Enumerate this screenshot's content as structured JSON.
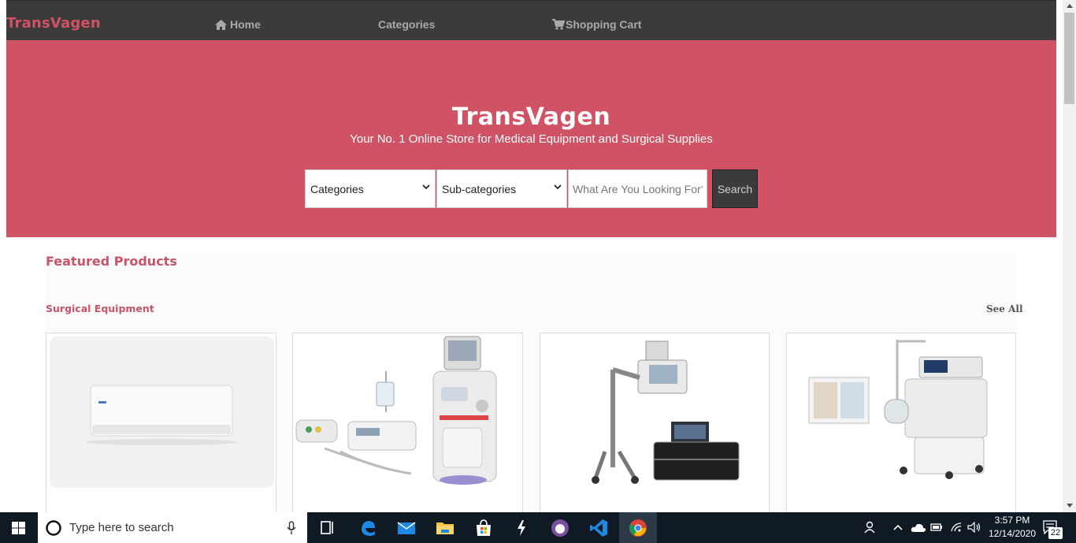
{
  "nav": {
    "brand": "TransVagen",
    "links": [
      {
        "label": "Home",
        "icon": "home-icon"
      },
      {
        "label": "Categories"
      },
      {
        "label": "Shopping Cart",
        "icon": "cart-icon"
      }
    ]
  },
  "hero": {
    "title": "TransVagen",
    "subtitle": "Your No. 1 Online Store for Medical Equipment and Surgical Supplies",
    "category_select": "Categories",
    "subcategory_select": "Sub-categories",
    "search_placeholder": "What Are You Looking For?",
    "search_button": "Search"
  },
  "featured": {
    "title": "Featured Products",
    "section": "Surgical Equipment",
    "see_all": "See All",
    "products": [
      {
        "image": "air-conditioner-unit"
      },
      {
        "image": "dialysis-machine"
      },
      {
        "image": "portable-x-ray"
      },
      {
        "image": "anesthesia-ventilator"
      }
    ]
  },
  "taskbar": {
    "search_placeholder": "Type here to search",
    "time": "3:57 PM",
    "date": "12/14/2020",
    "notification_count": "22"
  },
  "colors": {
    "brand": "#d05265",
    "nav_bg": "#3b3b3b",
    "taskbar_bg": "#101a24"
  }
}
